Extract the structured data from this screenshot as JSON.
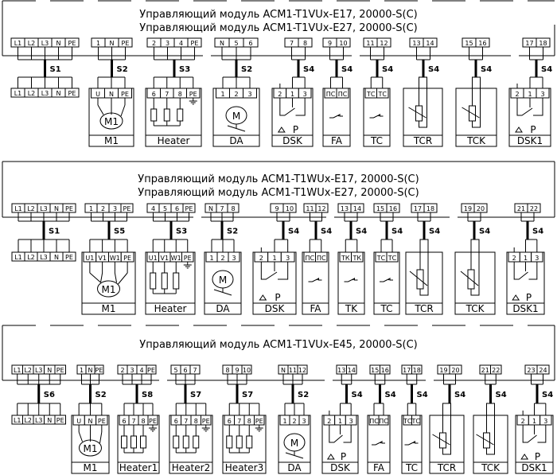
{
  "sections": [
    {
      "title_lines": [
        "Управляющий модуль ACM1-T1VUx-E17, 20000-S(C)",
        "Управляющий модуль ACM1-T1VUx-E27, 20000-S(C)"
      ],
      "blocks": [
        {
          "top": [
            "L1",
            "L2",
            "L3",
            "N",
            "PE"
          ],
          "cable": "S1",
          "device": {
            "type": "terminals",
            "terminals": [
              "L1",
              "L2",
              "L3",
              "N",
              "PE"
            ]
          }
        },
        {
          "top": [
            "1",
            "N",
            "PE"
          ],
          "cable": "S2",
          "device": {
            "type": "motor",
            "terminals": [
              "U",
              "N",
              "PE"
            ],
            "name": "M1",
            "symbol": "M1"
          }
        },
        {
          "top": [
            "2",
            "3",
            "4",
            "PE"
          ],
          "cable": "S3",
          "device": {
            "type": "heater",
            "terminals": [
              "6",
              "7",
              "8",
              "PE"
            ],
            "name": "Heater"
          }
        },
        {
          "top": [
            "N",
            "5",
            "6"
          ],
          "cable": "S2",
          "device": {
            "type": "damper",
            "terminals": [
              "1",
              "2",
              "3"
            ],
            "name": "DA",
            "symbol": "M"
          }
        },
        {
          "top": [
            "7",
            "8"
          ],
          "cable": "S4",
          "device": {
            "type": "pressure",
            "terminals": [
              "2",
              "1",
              "3"
            ],
            "name": "DSK",
            "symbol": "P"
          }
        },
        {
          "top": [
            "9",
            "10"
          ],
          "cable": "S4",
          "device": {
            "type": "switch",
            "terminals": [
              "ПС",
              "ПС"
            ],
            "name": "FA"
          }
        },
        {
          "top": [
            "11",
            "12"
          ],
          "cable": "S4",
          "device": {
            "type": "switch",
            "terminals": [
              "ТС",
              "ТС"
            ],
            "name": "TC"
          }
        },
        {
          "top": [
            "13",
            "14"
          ],
          "cable": "S4",
          "device": {
            "type": "thermistor",
            "terminals": [],
            "name": "TCR"
          }
        },
        {
          "top": [
            "15",
            "16"
          ],
          "cable": "S4",
          "device": {
            "type": "thermistor",
            "terminals": [],
            "name": "TCK"
          }
        },
        {
          "top": [
            "17",
            "18"
          ],
          "cable": "S4",
          "device": {
            "type": "pressure",
            "terminals": [
              "2",
              "1",
              "3"
            ],
            "name": "DSK1",
            "symbol": "P"
          }
        }
      ]
    },
    {
      "title_lines": [
        "Управляющий модуль ACM1-T1WUx-E17, 20000-S(C)",
        "Управляющий модуль ACM1-T1WUx-E27, 20000-S(C)"
      ],
      "blocks": [
        {
          "top": [
            "L1",
            "L2",
            "L3",
            "N",
            "PE"
          ],
          "cable": "S1",
          "device": {
            "type": "terminals",
            "terminals": [
              "L1",
              "L2",
              "L3",
              "N",
              "PE"
            ]
          }
        },
        {
          "top": [
            "1",
            "2",
            "3",
            "PE"
          ],
          "cable": "S5",
          "device": {
            "type": "motor",
            "terminals": [
              "U1",
              "V1",
              "W1",
              "PE"
            ],
            "name": "M1",
            "symbol": "M1"
          }
        },
        {
          "top": [
            "4",
            "5",
            "6",
            "PE"
          ],
          "cable": "S3",
          "device": {
            "type": "heater",
            "terminals": [
              "U1",
              "V1",
              "W1",
              "PE"
            ],
            "name": "Heater"
          }
        },
        {
          "top": [
            "N",
            "7",
            "8"
          ],
          "cable": "S2",
          "device": {
            "type": "damper",
            "terminals": [
              "1",
              "2",
              "3"
            ],
            "name": "DA",
            "symbol": "M"
          }
        },
        {
          "top": [
            "9",
            "10"
          ],
          "cable": "S4",
          "device": {
            "type": "pressure",
            "terminals": [
              "2",
              "1",
              "3"
            ],
            "name": "DSK",
            "symbol": "P"
          }
        },
        {
          "top": [
            "11",
            "12"
          ],
          "cable": "S4",
          "device": {
            "type": "switch",
            "terminals": [
              "ПС",
              "ПС"
            ],
            "name": "FA"
          }
        },
        {
          "top": [
            "13",
            "14"
          ],
          "cable": "S4",
          "device": {
            "type": "switch",
            "terminals": [
              "ТК",
              "ТК"
            ],
            "name": "TK"
          }
        },
        {
          "top": [
            "15",
            "16"
          ],
          "cable": "S4",
          "device": {
            "type": "switch",
            "terminals": [
              "ТС",
              "ТС"
            ],
            "name": "TC"
          }
        },
        {
          "top": [
            "17",
            "18"
          ],
          "cable": "S4",
          "device": {
            "type": "thermistor",
            "terminals": [],
            "name": "TCR"
          }
        },
        {
          "top": [
            "19",
            "20"
          ],
          "cable": "S4",
          "device": {
            "type": "thermistor",
            "terminals": [],
            "name": "TCK"
          }
        },
        {
          "top": [
            "21",
            "22"
          ],
          "cable": "S4",
          "device": {
            "type": "pressure",
            "terminals": [
              "2",
              "1",
              "3"
            ],
            "name": "DSK1",
            "symbol": "P"
          }
        }
      ]
    },
    {
      "title_lines": [
        "Управляющий модуль ACM1-T1VUx-E45, 20000-S(C)"
      ],
      "blocks": [
        {
          "top": [
            "L1",
            "L2",
            "L3",
            "N",
            "PE"
          ],
          "cable": "S6",
          "device": {
            "type": "terminals",
            "terminals": [
              "L1",
              "L2",
              "L3",
              "N",
              "PE"
            ]
          }
        },
        {
          "top": [
            "1",
            "N",
            "PE"
          ],
          "cable": "S2",
          "device": {
            "type": "motor",
            "terminals": [
              "U",
              "N",
              "PE"
            ],
            "name": "M1",
            "symbol": "M1"
          }
        },
        {
          "top": [
            "2",
            "3",
            "4",
            "PE"
          ],
          "cable": "S8",
          "device": {
            "type": "heater",
            "terminals": [
              "6",
              "7",
              "8",
              "PE"
            ],
            "name": "Heater1"
          }
        },
        {
          "top": [
            "5",
            "6",
            "7"
          ],
          "cable": "S7",
          "device": {
            "type": "heater",
            "terminals": [
              "6",
              "7",
              "8",
              "PE"
            ],
            "name": "Heater2"
          }
        },
        {
          "top": [
            "8",
            "9",
            "10"
          ],
          "cable": "S7",
          "device": {
            "type": "heater",
            "terminals": [
              "6",
              "7",
              "8",
              "PE"
            ],
            "name": "Heater3"
          }
        },
        {
          "top": [
            "N",
            "11",
            "12"
          ],
          "cable": "S2",
          "device": {
            "type": "damper",
            "terminals": [
              "1",
              "2",
              "3"
            ],
            "name": "DA",
            "symbol": "M"
          }
        },
        {
          "top": [
            "13",
            "14"
          ],
          "cable": "S4",
          "device": {
            "type": "pressure",
            "terminals": [
              "2",
              "1",
              "3"
            ],
            "name": "DSK",
            "symbol": "P"
          }
        },
        {
          "top": [
            "15",
            "16"
          ],
          "cable": "S4",
          "device": {
            "type": "switch",
            "terminals": [
              "ПС",
              "ПС"
            ],
            "name": "FA"
          }
        },
        {
          "top": [
            "17",
            "18"
          ],
          "cable": "S4",
          "device": {
            "type": "switch",
            "terminals": [
              "ТС",
              "ТС"
            ],
            "name": "TC"
          }
        },
        {
          "top": [
            "19",
            "20"
          ],
          "cable": "S4",
          "device": {
            "type": "thermistor",
            "terminals": [],
            "name": "TCR"
          }
        },
        {
          "top": [
            "21",
            "22"
          ],
          "cable": "S4",
          "device": {
            "type": "thermistor",
            "terminals": [],
            "name": "TCK"
          }
        },
        {
          "top": [
            "23",
            "24"
          ],
          "cable": "S4",
          "device": {
            "type": "pressure",
            "terminals": [
              "2",
              "1",
              "3"
            ],
            "name": "DSK1",
            "symbol": "P"
          }
        }
      ]
    }
  ]
}
